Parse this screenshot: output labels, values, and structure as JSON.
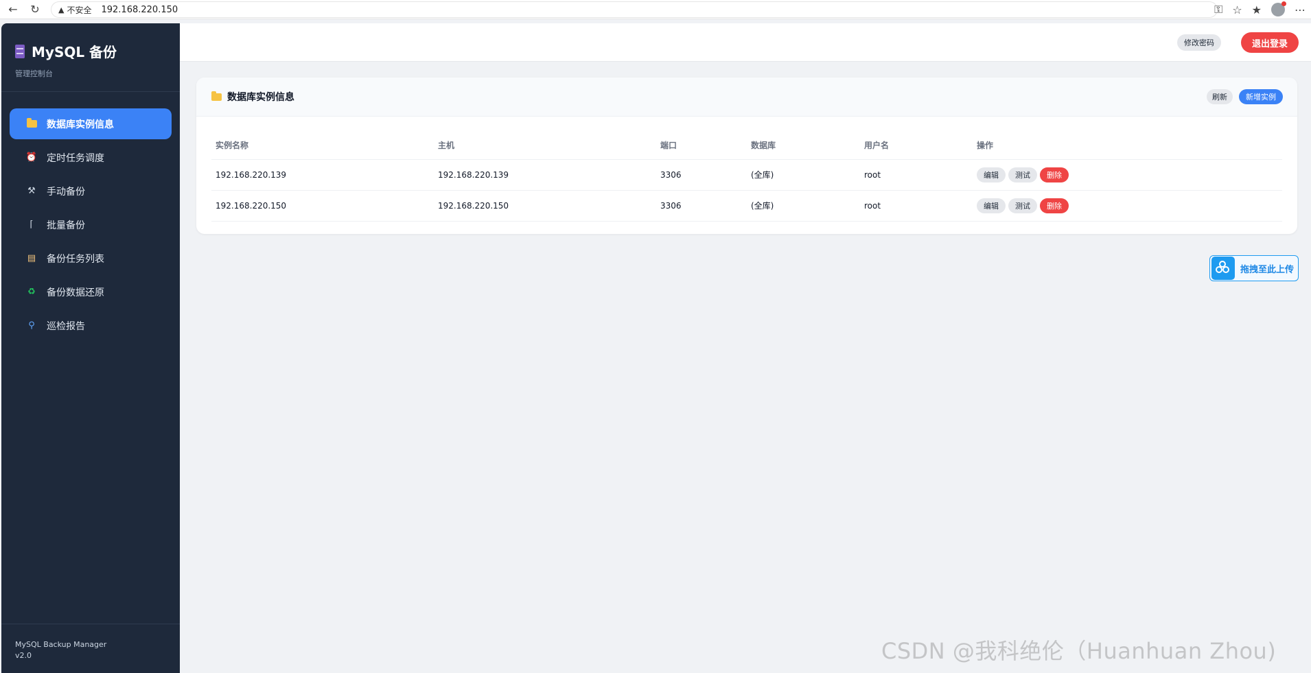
{
  "browser": {
    "security_label": "不安全",
    "url": "192.168.220.150"
  },
  "sidebar": {
    "title": "MySQL 备份",
    "subtitle": "管理控制台",
    "items": [
      {
        "label": "数据库实例信息",
        "icon": "folder-icon"
      },
      {
        "label": "定时任务调度",
        "icon": "alarm-clock-icon"
      },
      {
        "label": "手动备份",
        "icon": "tools-icon"
      },
      {
        "label": "批量备份",
        "icon": "paperclip-icon"
      },
      {
        "label": "备份任务列表",
        "icon": "clipboard-icon"
      },
      {
        "label": "备份数据还原",
        "icon": "recycle-icon"
      },
      {
        "label": "巡检报告",
        "icon": "magnifier-icon"
      }
    ],
    "footer_line1": "MySQL Backup Manager",
    "footer_line2": "v2.0"
  },
  "topbar": {
    "change_password_label": "修改密码",
    "logout_label": "退出登录"
  },
  "card": {
    "title": "数据库实例信息",
    "refresh_label": "刷新",
    "add_label": "新增实例",
    "columns": [
      "实例名称",
      "主机",
      "端口",
      "数据库",
      "用户名",
      "操作"
    ],
    "rows": [
      {
        "name": "192.168.220.139",
        "host": "192.168.220.139",
        "port": "3306",
        "database": "(全库)",
        "user": "root"
      },
      {
        "name": "192.168.220.150",
        "host": "192.168.220.150",
        "port": "3306",
        "database": "(全库)",
        "user": "root"
      }
    ],
    "op_edit": "编辑",
    "op_test": "测试",
    "op_delete": "删除"
  },
  "upload_widget": {
    "label": "拖拽至此上传"
  },
  "watermark": "CSDN @我科绝伦（Huanhuan Zhou)",
  "colors": {
    "sidebar_bg": "#1e293b",
    "accent": "#3b82f6",
    "danger": "#ef4444",
    "page_bg": "#f0f2f5"
  }
}
